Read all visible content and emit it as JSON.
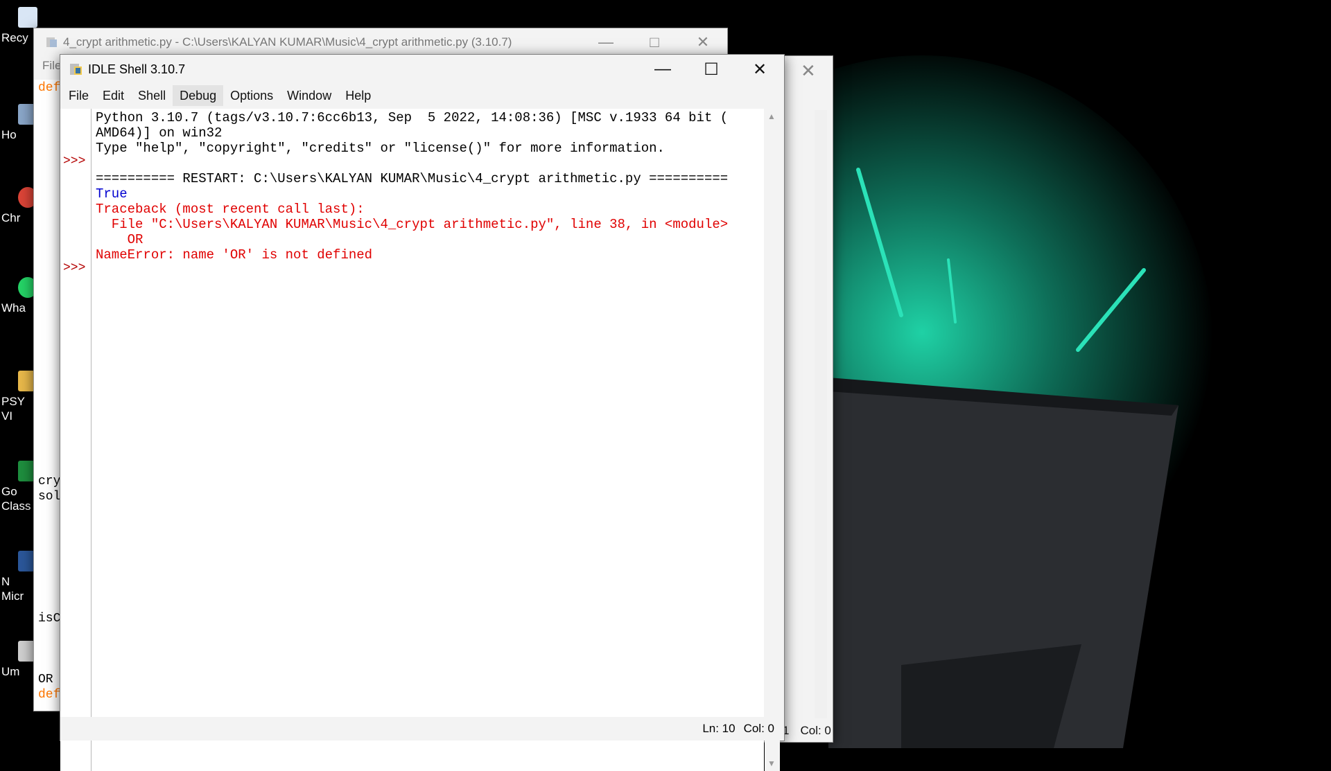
{
  "desktop": {
    "icons": [
      {
        "label": "Recy",
        "color": "#3a7bd5"
      },
      {
        "label": "Ho",
        "color": "#8aa6c8"
      },
      {
        "label": "Chr",
        "color": "#db4437"
      },
      {
        "label": "Wha",
        "color": "#25d366"
      },
      {
        "label": "PSY\nVI",
        "color": "#e8b84a"
      },
      {
        "label": "Go\nClass",
        "color": "#1e8e3e"
      },
      {
        "label": "N\nMicr",
        "color": "#2b579a"
      },
      {
        "label": "Um",
        "color": "#cfcfcf"
      }
    ]
  },
  "bg_editor": {
    "title": "4_crypt arithmetic.py - C:\\Users\\KALYAN KUMAR\\Music\\4_crypt arithmetic.py (3.10.7)",
    "menu_first": "File",
    "code_fragments": [
      {
        "text": "def",
        "color": "#ff7700"
      },
      {
        "text": "cry",
        "color": "#000000"
      },
      {
        "text": "sol",
        "color": "#000000"
      },
      {
        "text": "isC",
        "color": "#000000"
      },
      {
        "text": "OR",
        "color": "#000000"
      },
      {
        "text": "def",
        "color": "#ff7700"
      }
    ]
  },
  "bg_right": {
    "status_ln": "1",
    "status_col": "Col: 0"
  },
  "shell": {
    "title": "IDLE Shell 3.10.7",
    "menu": [
      "File",
      "Edit",
      "Shell",
      "Debug",
      "Options",
      "Window",
      "Help"
    ],
    "active_menu": "Debug",
    "prompts": [
      ">>>",
      ">>>"
    ],
    "lines": [
      {
        "text": "Python 3.10.7 (tags/v3.10.7:6cc6b13, Sep  5 2022, 14:08:36) [MSC v.1933 64 bit (",
        "style": "normal"
      },
      {
        "text": "AMD64)] on win32",
        "style": "normal"
      },
      {
        "text": "Type \"help\", \"copyright\", \"credits\" or \"license()\" for more information.",
        "style": "normal"
      },
      {
        "text": "",
        "style": "normal"
      },
      {
        "text": "========== RESTART: C:\\Users\\KALYAN KUMAR\\Music\\4_crypt arithmetic.py ==========",
        "style": "normal"
      },
      {
        "text": "True",
        "style": "blue"
      },
      {
        "text": "Traceback (most recent call last):",
        "style": "red"
      },
      {
        "text": "  File \"C:\\Users\\KALYAN KUMAR\\Music\\4_crypt arithmetic.py\", line 38, in <module>",
        "style": "red"
      },
      {
        "text": "    OR",
        "style": "red"
      },
      {
        "text": "NameError: name 'OR' is not defined",
        "style": "red"
      }
    ],
    "status_ln": "Ln: 10",
    "status_col": "Col: 0"
  }
}
